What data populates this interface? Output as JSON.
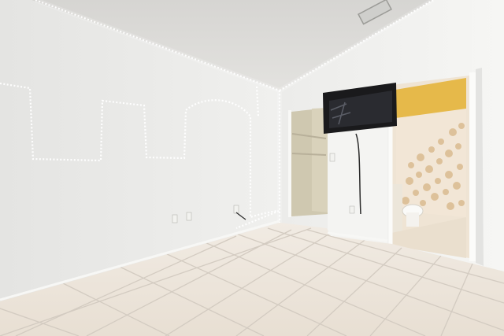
{
  "scene": {
    "kind": "photo",
    "subject": "empty-bedroom",
    "colors": {
      "ceiling": "#dddcda",
      "left_wall": "#ececea",
      "right_wall": "#f1f1ef",
      "floor": "#eae2d8",
      "grout": "#d3cbc1",
      "led": "#ffffff",
      "closet": "#d6cfb8",
      "bath_wall": "#e6b94a",
      "curtain": "#f2e6d6",
      "tv": "#1a1a1c"
    }
  }
}
